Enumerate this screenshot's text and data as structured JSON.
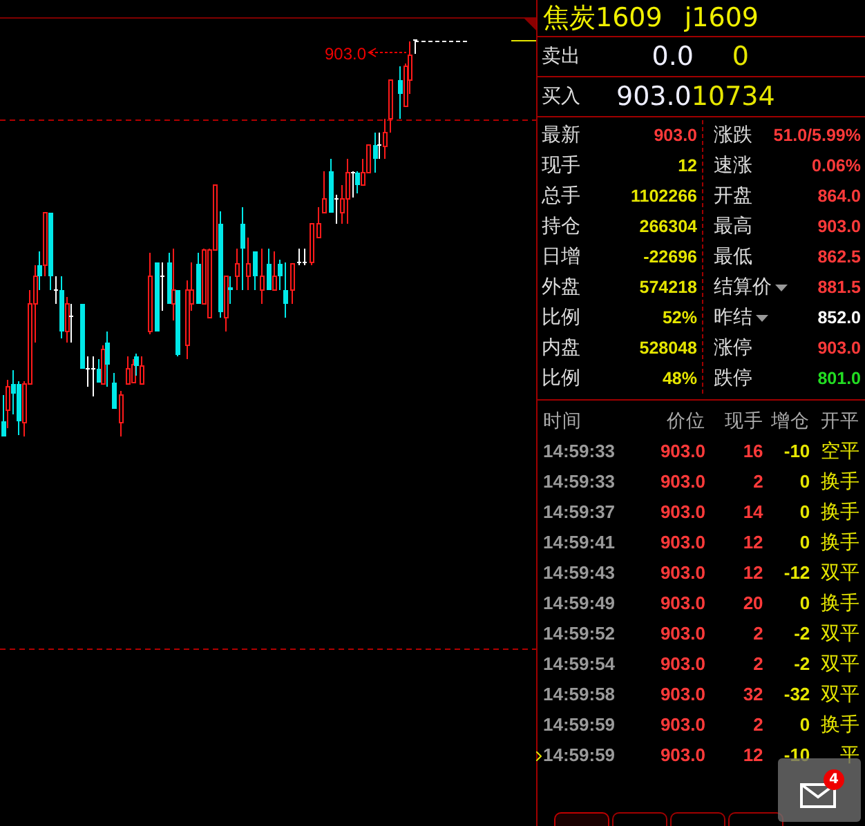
{
  "chart": {
    "price_label": "903.0"
  },
  "quote": {
    "name": "焦炭1609",
    "code": "j1609",
    "ask": {
      "label": "卖出",
      "price": "0.0",
      "volume": "0"
    },
    "bid": {
      "label": "买入",
      "price": "903.0",
      "volume": "10734"
    }
  },
  "stats": [
    {
      "label": "最新",
      "value": "903.0",
      "color": "#ff3a3a"
    },
    {
      "label": "现手",
      "value": "12",
      "color": "#e6e600"
    },
    {
      "label": "总手",
      "value": "1102266",
      "color": "#e6e600"
    },
    {
      "label": "持仓",
      "value": "266304",
      "color": "#e6e600"
    },
    {
      "label": "日增",
      "value": "-22696",
      "color": "#e6e600"
    },
    {
      "label": "外盘",
      "value": "574218",
      "color": "#e6e600"
    },
    {
      "label": "比例",
      "value": "52%",
      "color": "#e6e600"
    },
    {
      "label": "内盘",
      "value": "528048",
      "color": "#e6e600"
    },
    {
      "label": "比例",
      "value": "48%",
      "color": "#e6e600"
    }
  ],
  "stats_right": [
    {
      "label": "涨跌",
      "value": "51.0/5.99%",
      "color": "#ff3a3a",
      "kind": "plain"
    },
    {
      "label": "速涨",
      "value": "0.06%",
      "color": "#ff3a3a",
      "kind": "plain"
    },
    {
      "label": "开盘",
      "value": "864.0",
      "color": "#ff3a3a",
      "kind": "plain"
    },
    {
      "label": "最高",
      "value": "903.0",
      "color": "#ff3a3a",
      "kind": "plain"
    },
    {
      "label": "最低",
      "value": "862.5",
      "color": "#ff3a3a",
      "kind": "plain"
    },
    {
      "label": "结算价",
      "value": "881.5",
      "color": "#ff3a3a",
      "kind": "dropdown"
    },
    {
      "label": "昨结",
      "value": "852.0",
      "color": "#ffffff",
      "kind": "dropdown"
    },
    {
      "label": "涨停",
      "value": "903.0",
      "color": "#ff3a3a",
      "kind": "plain"
    },
    {
      "label": "跌停",
      "value": "801.0",
      "color": "#22dd22",
      "kind": "plain"
    }
  ],
  "trades": {
    "columns": [
      "时间",
      "价位",
      "现手",
      "增仓",
      "开平"
    ],
    "rows": [
      {
        "time": "14:59:33",
        "price": "903.0",
        "volume": "16",
        "oi_change": "-10",
        "type": "空平",
        "current": false
      },
      {
        "time": "14:59:33",
        "price": "903.0",
        "volume": "2",
        "oi_change": "0",
        "type": "换手",
        "current": false
      },
      {
        "time": "14:59:37",
        "price": "903.0",
        "volume": "14",
        "oi_change": "0",
        "type": "换手",
        "current": false
      },
      {
        "time": "14:59:41",
        "price": "903.0",
        "volume": "12",
        "oi_change": "0",
        "type": "换手",
        "current": false
      },
      {
        "time": "14:59:43",
        "price": "903.0",
        "volume": "12",
        "oi_change": "-12",
        "type": "双平",
        "current": false
      },
      {
        "time": "14:59:49",
        "price": "903.0",
        "volume": "20",
        "oi_change": "0",
        "type": "换手",
        "current": false
      },
      {
        "time": "14:59:52",
        "price": "903.0",
        "volume": "2",
        "oi_change": "-2",
        "type": "双平",
        "current": false
      },
      {
        "time": "14:59:54",
        "price": "903.0",
        "volume": "2",
        "oi_change": "-2",
        "type": "双平",
        "current": false
      },
      {
        "time": "14:59:58",
        "price": "903.0",
        "volume": "32",
        "oi_change": "-32",
        "type": "双平",
        "current": false
      },
      {
        "time": "14:59:59",
        "price": "903.0",
        "volume": "2",
        "oi_change": "0",
        "type": "换手",
        "current": false
      },
      {
        "time": "14:59:59",
        "price": "903.0",
        "volume": "12",
        "oi_change": "-10",
        "type": "平",
        "current": true
      }
    ]
  },
  "bottom_tabs": [
    {
      "selected": true
    },
    {
      "selected": false
    },
    {
      "selected": false
    },
    {
      "selected": false
    }
  ],
  "mail": {
    "badge": "4"
  }
}
